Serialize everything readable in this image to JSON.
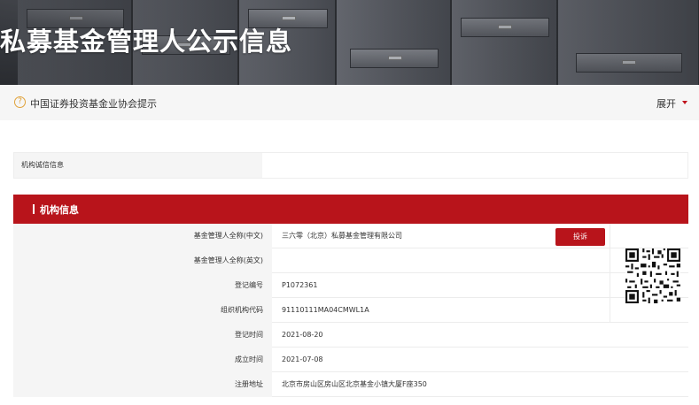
{
  "banner": {
    "title": "私募基金管理人公示信息"
  },
  "notice": {
    "icon": "question-circle-icon",
    "text": "中国证券投资基金业协会提示",
    "toggle_label": "展开"
  },
  "integrity": {
    "label": "机构诚信信息"
  },
  "section": {
    "title": "机构信息"
  },
  "rows": [
    {
      "label": "基金管理人全称(中文)",
      "value": "三六零（北京）私募基金管理有限公司"
    },
    {
      "label": "基金管理人全称(英文)",
      "value": ""
    },
    {
      "label": "登记编号",
      "value": "P1072361"
    },
    {
      "label": "组织机构代码",
      "value": "91110111MA04CMWL1A"
    },
    {
      "label": "登记时间",
      "value": "2021-08-20"
    },
    {
      "label": "成立时间",
      "value": "2021-07-08"
    },
    {
      "label": "注册地址",
      "value": "北京市房山区房山区北京基金小镇大厦F座350"
    }
  ],
  "complain_button": "投诉",
  "qr": {
    "icon": "qr-code-icon"
  },
  "colors": {
    "accent": "#b8141b",
    "notice_icon": "#e0a23a"
  }
}
